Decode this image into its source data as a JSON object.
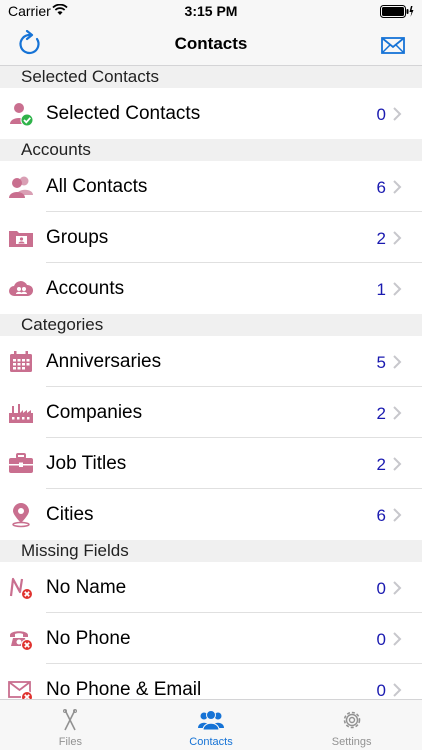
{
  "status": {
    "carrier": "Carrier",
    "time": "3:15 PM"
  },
  "nav": {
    "title": "Contacts"
  },
  "sections": [
    {
      "header": "Selected Contacts",
      "rows": [
        {
          "label": "Selected Contacts",
          "count": "0",
          "icon": "selected-contacts-icon"
        }
      ]
    },
    {
      "header": "Accounts",
      "rows": [
        {
          "label": "All Contacts",
          "count": "6",
          "icon": "all-contacts-icon"
        },
        {
          "label": "Groups",
          "count": "2",
          "icon": "groups-folder-icon"
        },
        {
          "label": "Accounts",
          "count": "1",
          "icon": "cloud-account-icon"
        }
      ]
    },
    {
      "header": "Categories",
      "rows": [
        {
          "label": "Anniversaries",
          "count": "5",
          "icon": "calendar-icon"
        },
        {
          "label": "Companies",
          "count": "2",
          "icon": "factory-icon"
        },
        {
          "label": "Job Titles",
          "count": "2",
          "icon": "briefcase-icon"
        },
        {
          "label": "Cities",
          "count": "6",
          "icon": "location-pin-icon"
        }
      ]
    },
    {
      "header": "Missing Fields",
      "rows": [
        {
          "label": "No Name",
          "count": "0",
          "icon": "no-name-icon"
        },
        {
          "label": "No Phone",
          "count": "0",
          "icon": "no-phone-icon"
        },
        {
          "label": "No Phone & Email",
          "count": "0",
          "icon": "no-phone-email-icon"
        }
      ]
    }
  ],
  "tabs": [
    {
      "label": "Files",
      "icon": "files-icon"
    },
    {
      "label": "Contacts",
      "icon": "contacts-icon"
    },
    {
      "label": "Settings",
      "icon": "settings-gear-icon"
    }
  ],
  "colors": {
    "accent": "#1673d6",
    "icon": "#c96f8f",
    "count": "#1a1ab0",
    "badge_ok": "#2fb34a",
    "badge_missing": "#e0332f"
  }
}
